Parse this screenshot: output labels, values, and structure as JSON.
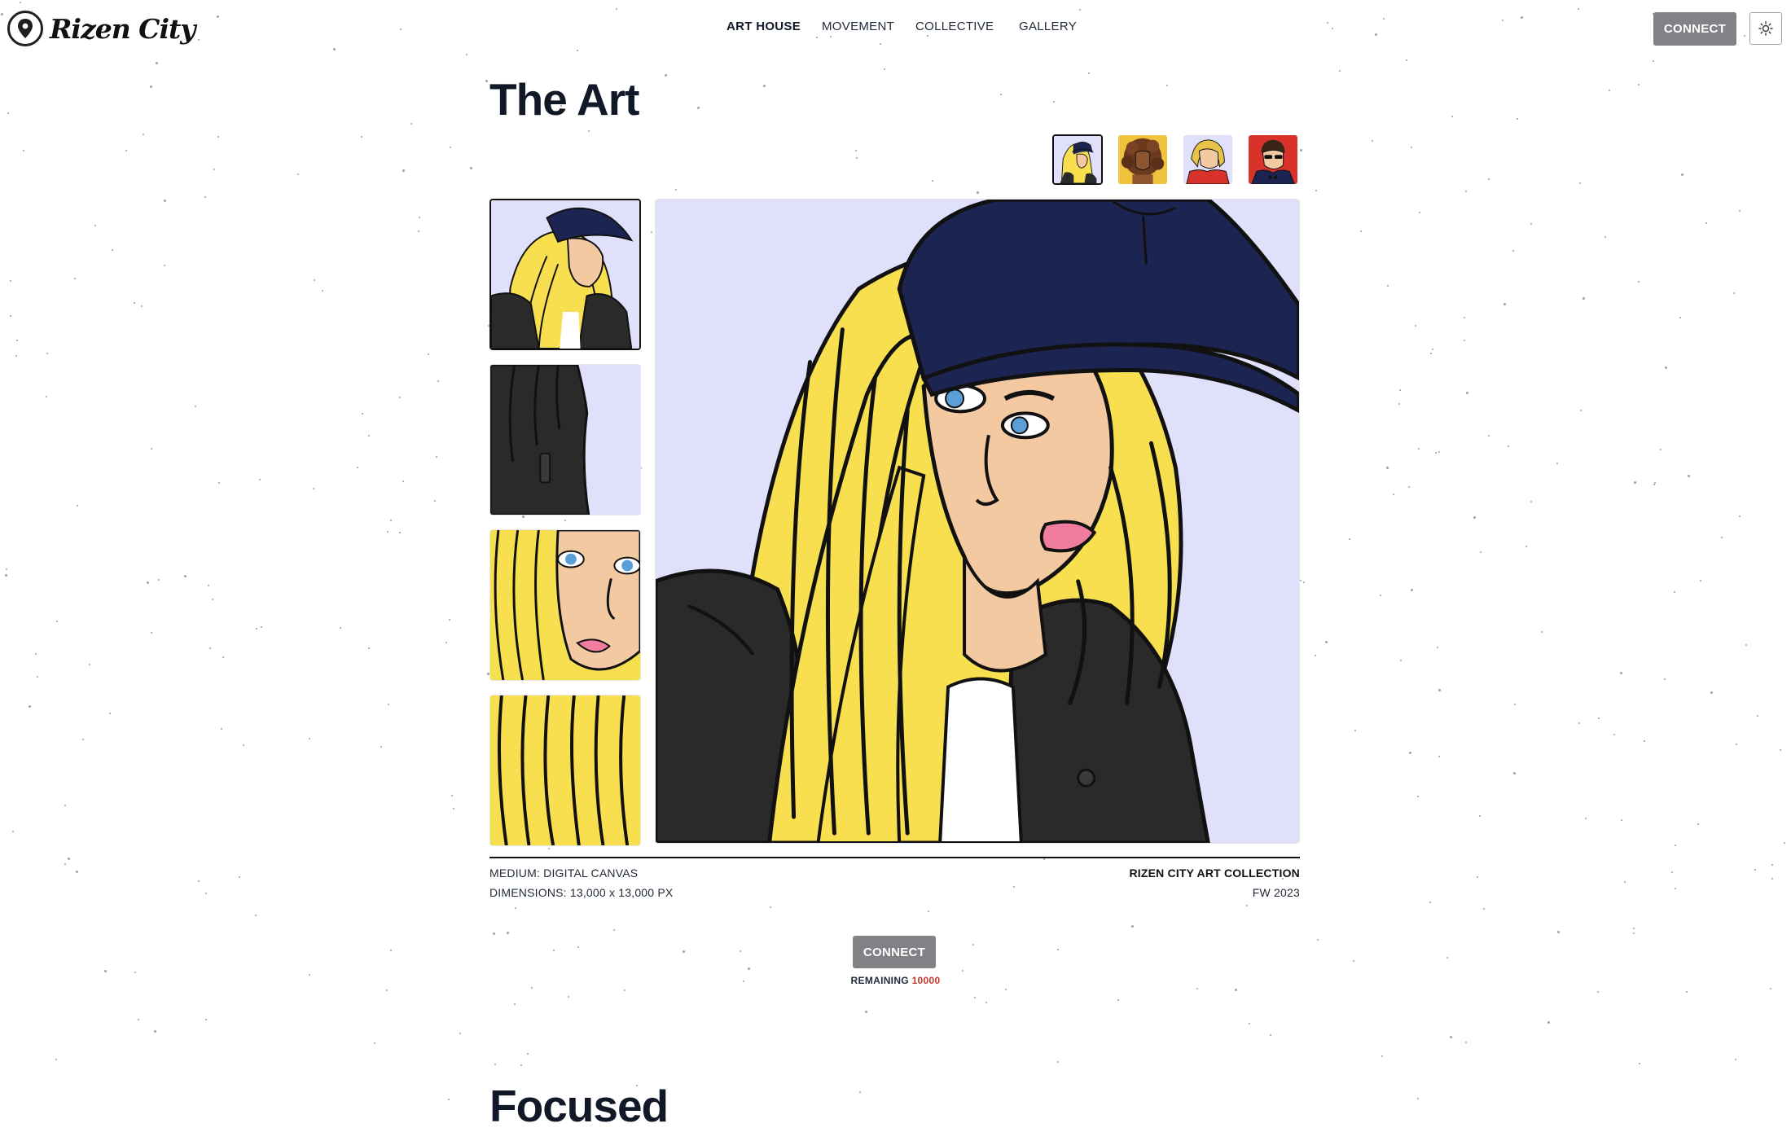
{
  "brand": {
    "name": "Rizen City",
    "logo_icon": "map-pin-icon"
  },
  "nav": {
    "items": [
      {
        "label": "ART HOUSE",
        "active": true
      },
      {
        "label": "MOVEMENT",
        "active": false
      },
      {
        "label": "COLLECTIVE",
        "active": false
      },
      {
        "label": "GALLERY",
        "active": false
      }
    ]
  },
  "header": {
    "connect_label": "CONNECT",
    "theme_icon": "sun-icon"
  },
  "art": {
    "title": "The Art",
    "characters": [
      {
        "name": "blonde-cap-character",
        "selected": true
      },
      {
        "name": "curly-hair-character",
        "selected": false
      },
      {
        "name": "red-jacket-character",
        "selected": false
      },
      {
        "name": "sunglasses-suit-character",
        "selected": false
      }
    ],
    "details": [
      {
        "name": "portrait-detail",
        "selected": true
      },
      {
        "name": "jacket-detail",
        "selected": false
      },
      {
        "name": "face-detail",
        "selected": false
      },
      {
        "name": "hair-detail",
        "selected": false
      }
    ],
    "medium": "MEDIUM: DIGITAL CANVAS",
    "dimensions": "DIMENSIONS: 13,000 x 13,000 PX",
    "collection": "RIZEN CITY ART COLLECTION",
    "season": "FW 2023",
    "connect_label": "CONNECT",
    "remaining_label": "REMAINING",
    "remaining_count": "10000"
  },
  "next_section": {
    "title": "Focused"
  },
  "colors": {
    "accent_button": "#808286",
    "remaining_count": "#c0392b",
    "art_background": "#e0e0fa",
    "hair": "#f7df4f",
    "cap": "#1c2451"
  }
}
